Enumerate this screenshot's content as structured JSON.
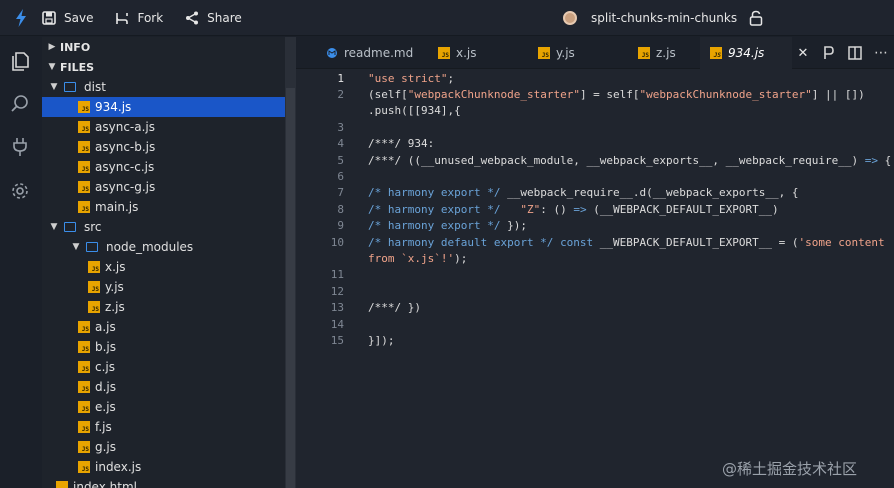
{
  "topbar": {
    "save_label": "Save",
    "fork_label": "Fork",
    "share_label": "Share",
    "sandbox_name": "split-chunks-min-chunks"
  },
  "sidebar": {
    "info_label": "INFO",
    "files_label": "FILES",
    "tree": [
      {
        "label": "dist",
        "type": "folder",
        "depth": 1,
        "open": true
      },
      {
        "label": "934.js",
        "type": "js",
        "depth": 2,
        "selected": true
      },
      {
        "label": "async-a.js",
        "type": "js",
        "depth": 2
      },
      {
        "label": "async-b.js",
        "type": "js",
        "depth": 2
      },
      {
        "label": "async-c.js",
        "type": "js",
        "depth": 2
      },
      {
        "label": "async-g.js",
        "type": "js",
        "depth": 2
      },
      {
        "label": "main.js",
        "type": "js",
        "depth": 2
      },
      {
        "label": "src",
        "type": "folder",
        "depth": 1,
        "open": true
      },
      {
        "label": "node_modules",
        "type": "folder",
        "depth": 2,
        "open": true
      },
      {
        "label": "x.js",
        "type": "js",
        "depth": 3
      },
      {
        "label": "y.js",
        "type": "js",
        "depth": 3
      },
      {
        "label": "z.js",
        "type": "js",
        "depth": 3
      },
      {
        "label": "a.js",
        "type": "js",
        "depth": 2
      },
      {
        "label": "b.js",
        "type": "js",
        "depth": 2
      },
      {
        "label": "c.js",
        "type": "js",
        "depth": 2
      },
      {
        "label": "d.js",
        "type": "js",
        "depth": 2
      },
      {
        "label": "e.js",
        "type": "js",
        "depth": 2
      },
      {
        "label": "f.js",
        "type": "js",
        "depth": 2
      },
      {
        "label": "g.js",
        "type": "js",
        "depth": 2
      },
      {
        "label": "index.js",
        "type": "js",
        "depth": 2
      },
      {
        "label": "index.html",
        "type": "html",
        "depth": 1
      }
    ]
  },
  "tabs": [
    {
      "label": "readme.md",
      "icon": "markdown-icon"
    },
    {
      "label": "x.js",
      "icon": "js-icon"
    },
    {
      "label": "y.js",
      "icon": "js-icon"
    },
    {
      "label": "z.js",
      "icon": "js-icon"
    },
    {
      "label": "934.js",
      "icon": "js-icon",
      "active": true
    }
  ],
  "editor": {
    "lines": [
      {
        "n": "1",
        "segs": [
          [
            "str",
            "\"use strict\""
          ],
          [
            "pl",
            ";"
          ]
        ]
      },
      {
        "n": "2",
        "segs": [
          [
            "pl",
            "(self["
          ],
          [
            "str",
            "\"webpackChunknode_starter\""
          ],
          [
            "pl",
            "] = self["
          ],
          [
            "str",
            "\"webpackChunknode_starter\""
          ],
          [
            "pl",
            "] || [])"
          ]
        ]
      },
      {
        "n": "",
        "segs": [
          [
            "pl",
            ".push([[934],{"
          ]
        ]
      },
      {
        "n": "3",
        "segs": []
      },
      {
        "n": "4",
        "segs": [
          [
            "pl",
            "/***/ 934:"
          ]
        ]
      },
      {
        "n": "5",
        "segs": [
          [
            "pl",
            "/***/ ((__unused_webpack_module, __webpack_exports__, __webpack_require__) "
          ],
          [
            "kw",
            "=>"
          ],
          [
            "pl",
            " {"
          ]
        ]
      },
      {
        "n": "6",
        "segs": []
      },
      {
        "n": "7",
        "segs": [
          [
            "cm",
            "/* harmony export */"
          ],
          [
            "pl",
            " __webpack_require__.d(__webpack_exports__, {"
          ]
        ]
      },
      {
        "n": "8",
        "segs": [
          [
            "cm",
            "/* harmony export */"
          ],
          [
            "pl",
            "   "
          ],
          [
            "str",
            "\"Z\""
          ],
          [
            "pl",
            ": () "
          ],
          [
            "kw",
            "=>"
          ],
          [
            "pl",
            " (__WEBPACK_DEFAULT_EXPORT__)"
          ]
        ]
      },
      {
        "n": "9",
        "segs": [
          [
            "cm",
            "/* harmony export */"
          ],
          [
            "pl",
            " });"
          ]
        ]
      },
      {
        "n": "10",
        "segs": [
          [
            "cm",
            "/* harmony default export */"
          ],
          [
            "pl",
            " "
          ],
          [
            "kw",
            "const"
          ],
          [
            "pl",
            " __WEBPACK_DEFAULT_EXPORT__ = ("
          ],
          [
            "str",
            "'some content"
          ]
        ]
      },
      {
        "n": "",
        "segs": [
          [
            "str",
            "from `x.js`!'"
          ],
          [
            "pl",
            ");"
          ]
        ]
      },
      {
        "n": "11",
        "segs": []
      },
      {
        "n": "12",
        "segs": []
      },
      {
        "n": "13",
        "segs": [
          [
            "pl",
            "/***/ })"
          ]
        ]
      },
      {
        "n": "14",
        "segs": []
      },
      {
        "n": "15",
        "segs": [
          [
            "pl",
            "}]);"
          ]
        ]
      }
    ]
  },
  "watermark": "@稀土掘金技术社区",
  "colors": {
    "selection": "#1a56c8",
    "js_icon": "#e8a400",
    "folder": "#3b8eea"
  }
}
